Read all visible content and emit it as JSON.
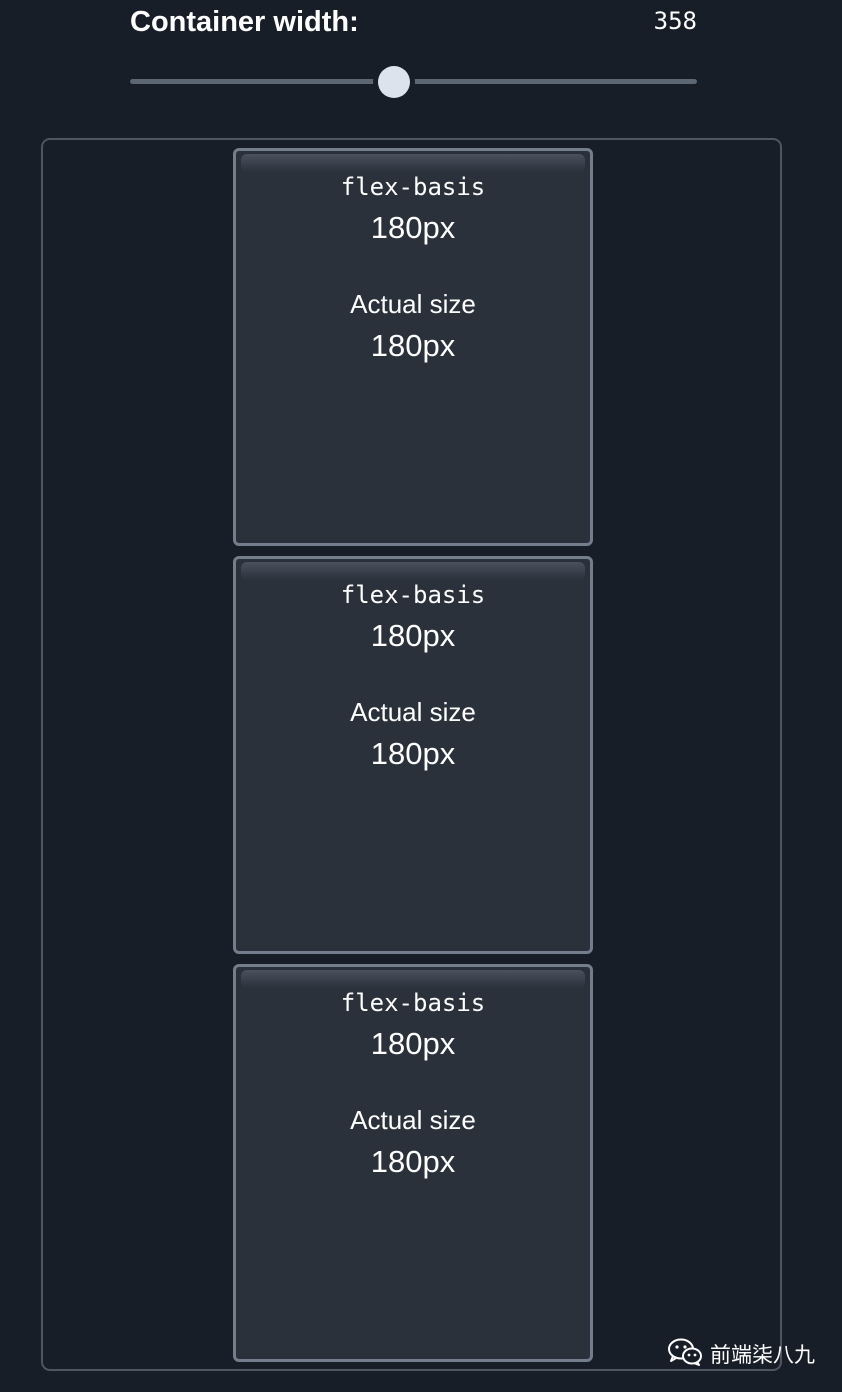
{
  "control": {
    "label": "Container width:",
    "value": "358",
    "slider_fraction": 0.465
  },
  "items": [
    {
      "basis_label": "flex-basis",
      "basis_value": "180px",
      "actual_label": "Actual size",
      "actual_value": "180px"
    },
    {
      "basis_label": "flex-basis",
      "basis_value": "180px",
      "actual_label": "Actual size",
      "actual_value": "180px"
    },
    {
      "basis_label": "flex-basis",
      "basis_value": "180px",
      "actual_label": "Actual size",
      "actual_value": "180px"
    }
  ],
  "watermark": {
    "icon": "wechat-icon",
    "text": "前端柒八九"
  },
  "colors": {
    "background": "#181e28",
    "item_fill": "#2b313b",
    "item_border": "#747d8b",
    "slider_thumb": "#dde3ec",
    "slider_track": "#5d6673"
  }
}
